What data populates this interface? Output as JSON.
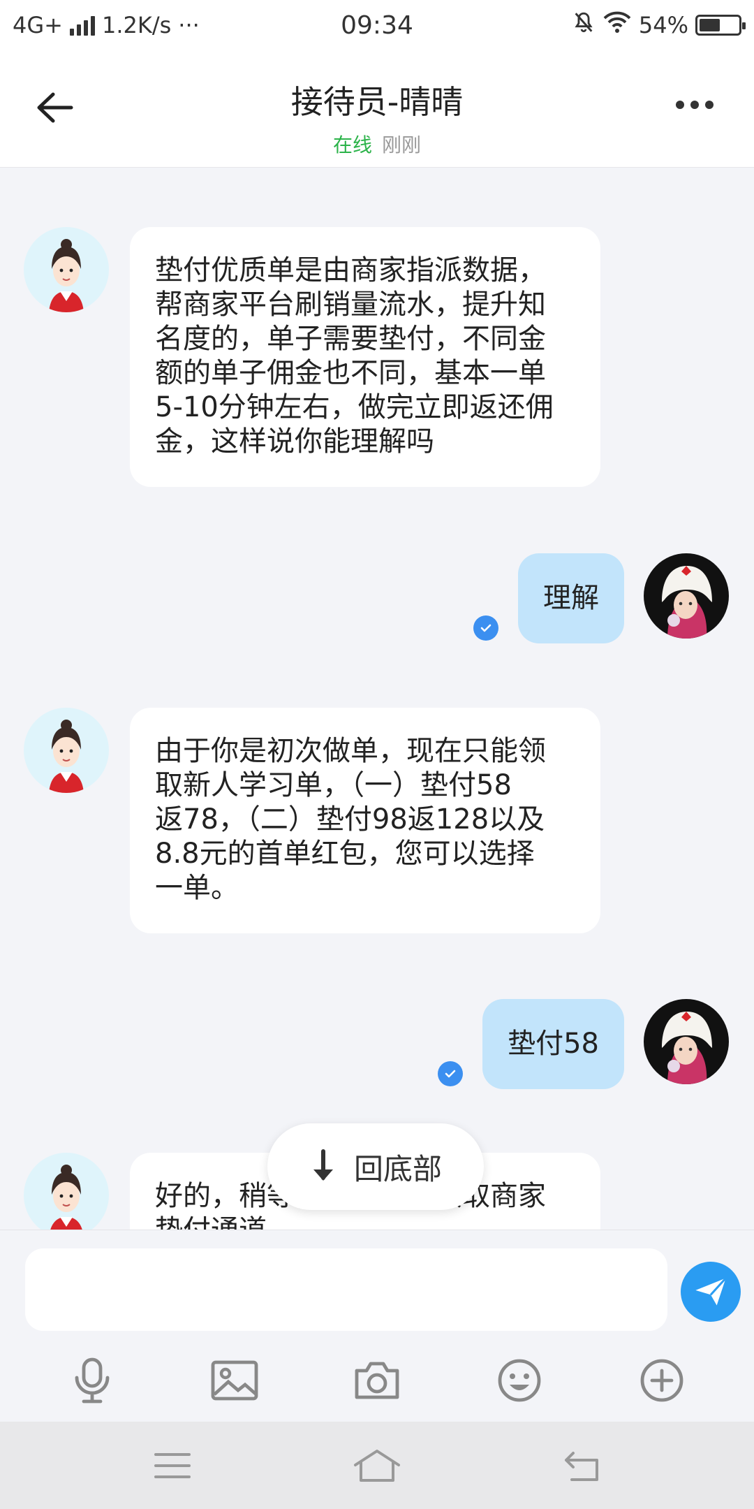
{
  "status_bar": {
    "network": "4G+",
    "speed": "1.2K/s",
    "more": "···",
    "time": "09:34",
    "battery": "54%",
    "battery_level": 0.54
  },
  "header": {
    "title": "接待员-晴晴",
    "status": "在线",
    "last_seen": "刚刚"
  },
  "messages": [
    {
      "from": "agent",
      "text": "垫付优质单是由商家指派数据，\n帮商家平台刷销量流水，提升知\n名度的，单子需要垫付，不同金\n额的单子佣金也不同，基本一单\n5-10分钟左右，做完立即返还佣\n金，这样说你能理解吗"
    },
    {
      "from": "me",
      "text": "理解",
      "read": true
    },
    {
      "from": "agent",
      "text": "由于你是初次做单，现在只能领\n取新人学习单，（一）垫付58\n返78，（二）垫付98返128以及\n8.8元的首单红包，您可以选择\n一单。"
    },
    {
      "from": "me",
      "text": "垫付58",
      "read": true
    },
    {
      "from": "agent",
      "text": "好的，稍等，我在为您获取商家\n垫付通道"
    }
  ],
  "scroll_bottom_label": "回底部",
  "input": {
    "placeholder": "",
    "value": ""
  },
  "colors": {
    "accent": "#2a9cf2",
    "online": "#2cb34a",
    "out_bubble": "#c2e4fb"
  }
}
